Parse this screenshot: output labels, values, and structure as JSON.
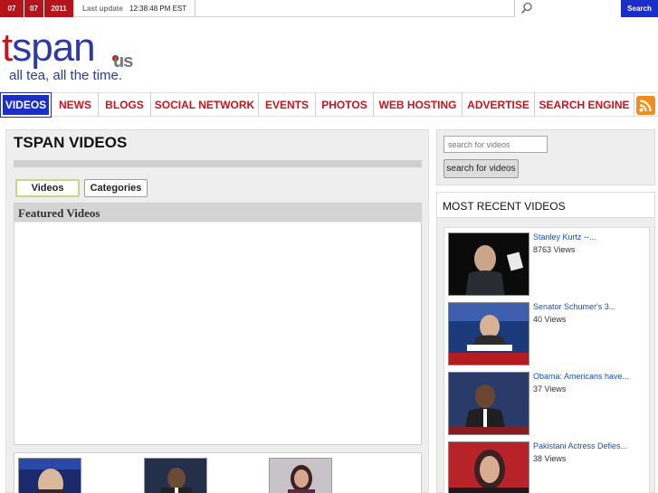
{
  "topbar": {
    "date": [
      "07",
      "07",
      "2011"
    ],
    "last_update_label": "Last update",
    "last_update_time": "12:38:48 PM EST",
    "search_button": "Search"
  },
  "logo": {
    "name": "tspan",
    "suffix": "us",
    "tagline": "all tea, all the time."
  },
  "nav": {
    "items": [
      "VIDEOS",
      "NEWS",
      "BLOGS",
      "SOCIAL NETWORK",
      "EVENTS",
      "PHOTOS",
      "WEB HOSTING",
      "ADVERTISE",
      "SEARCH ENGINE"
    ],
    "active": "VIDEOS"
  },
  "main": {
    "title": "TSPAN VIDEOS",
    "tabs": [
      "Videos",
      "Categories"
    ],
    "featured_heading": "Featured Videos"
  },
  "sidebar": {
    "search_placeholder": "search for videos",
    "search_button": "search for videos",
    "recent_heading": "MOST RECENT VIDEOS",
    "recent": [
      {
        "title": "Stanley Kurtz --...",
        "views": "8763 Views"
      },
      {
        "title": "Senator Schumer's 3...",
        "views": "40 Views"
      },
      {
        "title": "Obama: Americans have...",
        "views": "37 Views"
      },
      {
        "title": "Pakistani Actress Defies...",
        "views": "38 Views"
      }
    ]
  },
  "colors": {
    "brand_red": "#c5161d",
    "brand_blue": "#1b2fc8",
    "logo_blue": "#2d3aa5",
    "link_blue": "#1b4fbf",
    "rss_orange": "#f28c1b"
  },
  "icons": {
    "search": "magnifier-icon",
    "feed": "rss-icon"
  }
}
